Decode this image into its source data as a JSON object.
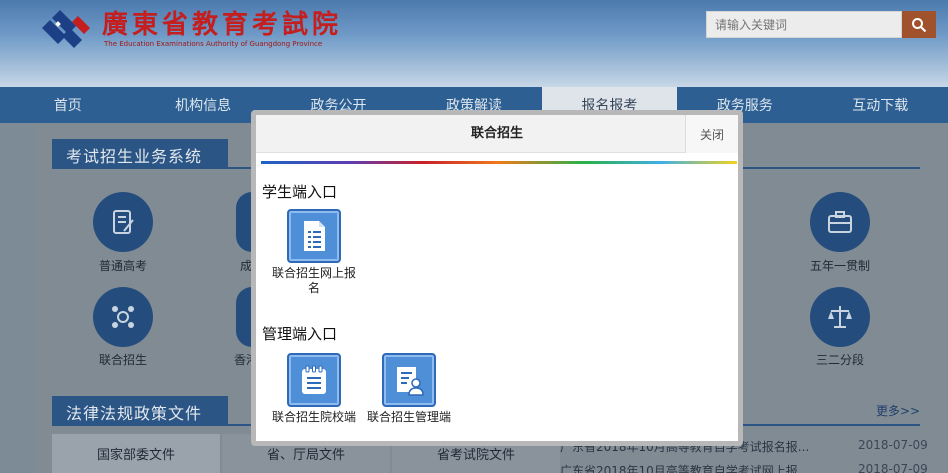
{
  "header": {
    "site_title": "廣東省教育考試院",
    "site_subtitle": "The Education Examinations Authority of Guangdong Province",
    "search_placeholder": "请输入关键词"
  },
  "nav": {
    "items": [
      {
        "label": "首页"
      },
      {
        "label": "机构信息"
      },
      {
        "label": "政务公开"
      },
      {
        "label": "政策解读"
      },
      {
        "label": "报名报考",
        "active": true
      },
      {
        "label": "政务服务"
      },
      {
        "label": "互动下载"
      }
    ]
  },
  "background": {
    "section1_title": "考试招生业务系统",
    "services": [
      "普通高考",
      "成",
      "五年一贯制",
      "联合招生",
      "香港",
      "三二分段"
    ],
    "section2_title": "法律法规政策文件",
    "more_link": "更多>>",
    "tabs": [
      "国家部委文件",
      "省、厅局文件",
      "省考试院文件"
    ],
    "news": [
      {
        "title": "广东省2018年10月高等教育自学考试报名报...",
        "date": "2018-07-09"
      },
      {
        "title": "广东省2018年10月高等教育自学考试网上报...",
        "date": "2018-07-09"
      }
    ]
  },
  "modal": {
    "title": "联合招生",
    "close_label": "关闭",
    "student_group": {
      "title": "学生端入口",
      "items": [
        {
          "label": "联合招生网上报名",
          "icon": "document-list-icon"
        }
      ]
    },
    "admin_group": {
      "title": "管理端入口",
      "items": [
        {
          "label": "联合招生院校端",
          "icon": "notepad-icon"
        },
        {
          "label": "联合招生管理端",
          "icon": "user-document-icon"
        }
      ]
    }
  },
  "colors": {
    "nav_bg": "#2d5f92",
    "title_red": "#c41e1e",
    "tile_blue": "#4f8fd8",
    "section_bg": "#2b5585"
  }
}
